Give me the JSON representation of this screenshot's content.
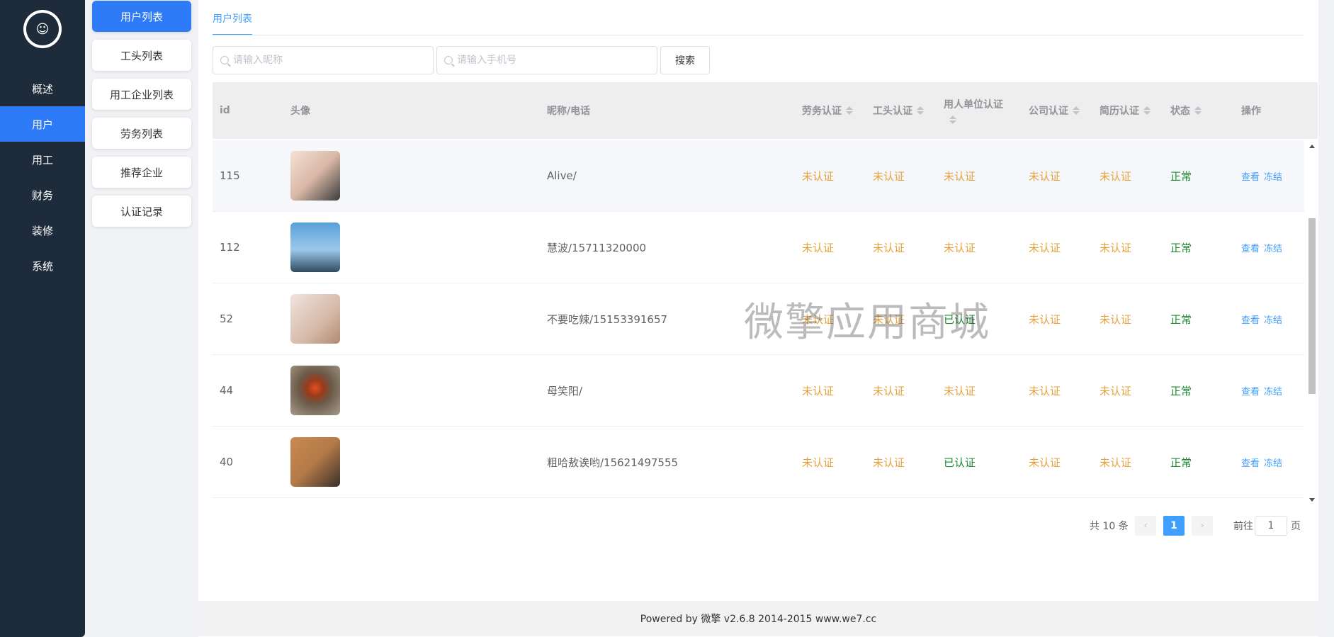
{
  "nav": {
    "logo_text": "☺",
    "items": [
      {
        "label": "概述"
      },
      {
        "label": "用户"
      },
      {
        "label": "用工"
      },
      {
        "label": "财务"
      },
      {
        "label": "装修"
      },
      {
        "label": "系统"
      }
    ],
    "active_index": 1
  },
  "submenu": {
    "items": [
      {
        "label": "用户列表"
      },
      {
        "label": "工头列表"
      },
      {
        "label": "用工企业列表"
      },
      {
        "label": "劳务列表"
      },
      {
        "label": "推荐企业"
      },
      {
        "label": "认证记录"
      }
    ],
    "active_index": 0
  },
  "tab": {
    "label": "用户列表"
  },
  "search": {
    "nickname_placeholder": "请输入昵称",
    "phone_placeholder": "请输入手机号",
    "button_label": "搜索"
  },
  "table": {
    "columns": {
      "id": "id",
      "avatar": "头像",
      "name_phone": "昵称/电话",
      "labor_cert": "劳务认证",
      "foreman_cert": "工头认证",
      "employer_cert": "用人单位认证",
      "company_cert": "公司认证",
      "resume_cert": "简历认证",
      "status": "状态",
      "actions": "操作"
    },
    "rows": [
      {
        "id": "115",
        "name_phone": "Alive/",
        "labor_cert": "未认证",
        "foreman_cert": "未认证",
        "employer_cert": "未认证",
        "company_cert": "未认证",
        "resume_cert": "未认证",
        "status": "正常",
        "view": "查看",
        "freeze": "冻结"
      },
      {
        "id": "112",
        "name_phone": "慧波/15711320000",
        "labor_cert": "未认证",
        "foreman_cert": "未认证",
        "employer_cert": "未认证",
        "company_cert": "未认证",
        "resume_cert": "未认证",
        "status": "正常",
        "view": "查看",
        "freeze": "冻结"
      },
      {
        "id": "52",
        "name_phone": "不要吃辣/15153391657",
        "labor_cert": "未认证",
        "foreman_cert": "未认证",
        "employer_cert": "已认证",
        "company_cert": "未认证",
        "resume_cert": "未认证",
        "status": "正常",
        "view": "查看",
        "freeze": "冻结"
      },
      {
        "id": "44",
        "name_phone": "母笑阳/",
        "labor_cert": "未认证",
        "foreman_cert": "未认证",
        "employer_cert": "未认证",
        "company_cert": "未认证",
        "resume_cert": "未认证",
        "status": "正常",
        "view": "查看",
        "freeze": "冻结"
      },
      {
        "id": "40",
        "name_phone": "粗哈敖诶哟/15621497555",
        "labor_cert": "未认证",
        "foreman_cert": "未认证",
        "employer_cert": "已认证",
        "company_cert": "未认证",
        "resume_cert": "未认证",
        "status": "正常",
        "view": "查看",
        "freeze": "冻结"
      }
    ]
  },
  "watermark": "微擎应用商城",
  "pagination": {
    "total_text": "共 10 条",
    "prev": "‹",
    "current_page": "1",
    "next": "›",
    "goto_label": "前往",
    "goto_value": "1",
    "page_suffix": "页"
  },
  "footer": {
    "text": "Powered by 微擎 v2.6.8 2014-2015 www.we7.cc"
  },
  "colors": {
    "sidebar_bg": "#1d2b3a",
    "accent": "#2d7bf6",
    "link": "#409eff",
    "warn": "#e6a23c",
    "ok": "#1e8a2f"
  }
}
